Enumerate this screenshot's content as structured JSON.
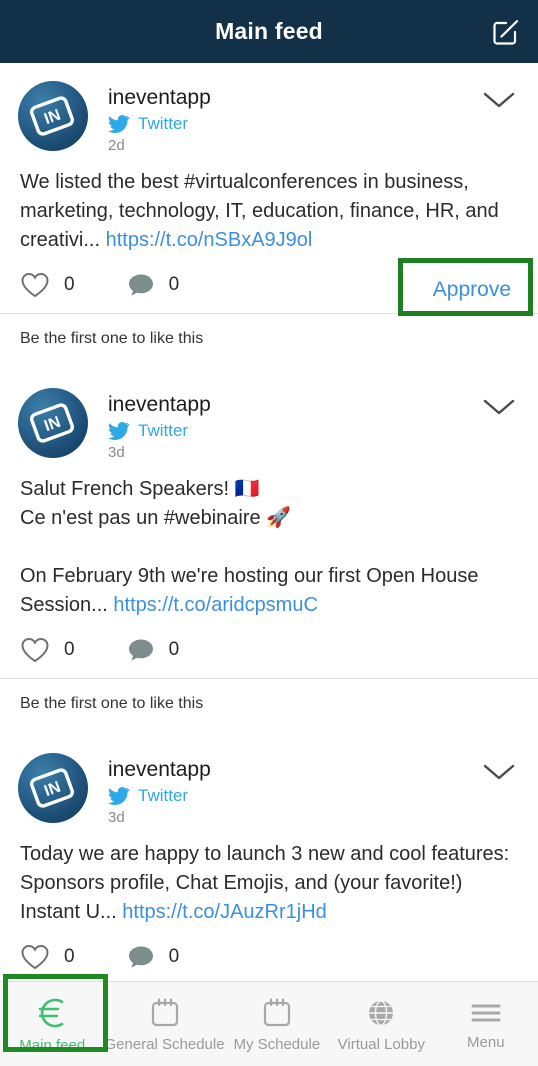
{
  "header": {
    "title": "Main feed",
    "compose_icon": "compose-icon"
  },
  "posts": [
    {
      "username": "ineventapp",
      "source": "Twitter",
      "source_icon": "twitter-bird-icon",
      "timestamp": "2d",
      "body_text": "We listed the best #virtualconferences in business, marketing, technology, IT, education, finance, HR, and creativi... ",
      "body_link": "https://t.co/nSBxA9J9ol",
      "like_count": "0",
      "comment_count": "0",
      "approve_label": "Approve",
      "likes_note": "Be the first one to like this"
    },
    {
      "username": "ineventapp",
      "source": "Twitter",
      "source_icon": "twitter-bird-icon",
      "timestamp": "3d",
      "body_text": "Salut French Speakers! 🇫🇷\nCe n'est pas un #webinaire 🚀\n\nOn February 9th we're hosting our first Open House Session... ",
      "body_link": "https://t.co/aridcpsmuC",
      "like_count": "0",
      "comment_count": "0",
      "approve_label": "",
      "likes_note": "Be the first one to like this"
    },
    {
      "username": "ineventapp",
      "source": "Twitter",
      "source_icon": "twitter-bird-icon",
      "timestamp": "3d",
      "body_text": "Today we are happy to launch 3 new and cool features: Sponsors profile, Chat Emojis, and (your favorite!) Instant U... ",
      "body_link": "https://t.co/JAuzRr1jHd",
      "like_count": "0",
      "comment_count": "0",
      "approve_label": "",
      "likes_note": ""
    }
  ],
  "bottom_nav": {
    "items": [
      {
        "label": "Main feed",
        "icon": "feed-icon",
        "active": true
      },
      {
        "label": "General Schedule",
        "icon": "calendar-icon",
        "active": false
      },
      {
        "label": "My Schedule",
        "icon": "calendar-icon",
        "active": false
      },
      {
        "label": "Virtual Lobby",
        "icon": "globe-icon",
        "active": false
      },
      {
        "label": "Menu",
        "icon": "hamburger-icon",
        "active": false
      }
    ]
  },
  "colors": {
    "header_bg": "#123048",
    "twitter_blue": "#2fa8e8",
    "link_blue": "#3b8fe0",
    "highlight_green": "#1f7d22",
    "active_nav_green": "#3fbf6f"
  }
}
